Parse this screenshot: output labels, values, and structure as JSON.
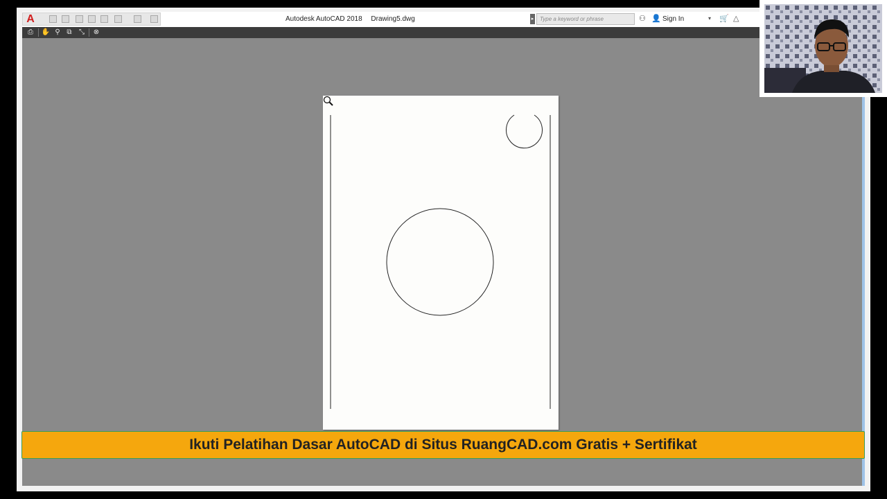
{
  "window": {
    "app_title": "Autodesk AutoCAD 2018",
    "file_name": "Drawing5.dwg"
  },
  "search": {
    "placeholder": "Type a keyword or phrase"
  },
  "account": {
    "sign_in_label": "Sign In"
  },
  "icons": {
    "app_logo": "A",
    "user": "👤",
    "binoculars": "⚇",
    "cart": "🛒",
    "a360": "△"
  },
  "toolbar": {
    "buttons": [
      "plot-icon",
      "pan-icon",
      "zoom-icon",
      "zoom-window-icon",
      "zoom-original-icon",
      "close-preview-icon"
    ]
  },
  "banner": {
    "text": "Ikuti Pelatihan Dasar AutoCAD di Situs RuangCAD.com Gratis + Sertifikat"
  },
  "colors": {
    "banner_bg": "#f5a70d",
    "viewport_bg": "#8a8a8a",
    "toolbar_bg": "#3c3c3c",
    "logo_red": "#d11e1e"
  }
}
